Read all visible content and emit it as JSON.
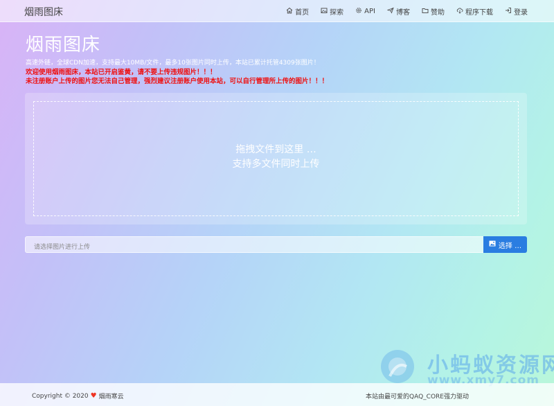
{
  "brand": "烟雨图床",
  "nav": [
    {
      "label": "首页",
      "icon": "home-icon"
    },
    {
      "label": "探索",
      "icon": "image-icon"
    },
    {
      "label": "API",
      "icon": "gear-icon"
    },
    {
      "label": "博客",
      "icon": "plane-icon"
    },
    {
      "label": "赞助",
      "icon": "folder-icon"
    },
    {
      "label": "程序下载",
      "icon": "cloud-download-icon"
    },
    {
      "label": "登录",
      "icon": "login-icon"
    }
  ],
  "hero": {
    "title": "烟雨图床",
    "description": "高速外链，全球CDN加速，支持最大10MB/文件，最多10张图片同时上传，本站已累计托管4309张图片！",
    "warning_1": "欢迎使用烟雨图床，本站已开启鉴黄，请不要上传违规图片！！！",
    "warning_2": "未注册账户上传的图片您无法自己管理，强烈建议注册账户使用本站，可以自行管理所上传的图片！！！"
  },
  "upload": {
    "drop_line_1": "拖拽文件到这里 …",
    "drop_line_2": "支持多文件同时上传",
    "input_placeholder": "请选择图片进行上传",
    "select_button": "选择 …"
  },
  "watermark": {
    "title": "小蚂蚁资源网",
    "url": "www.xmy7.com"
  },
  "footer": {
    "copyright": "Copyright © 2020",
    "site": "烟雨寒云",
    "powered": "本站由最可爱的QAQ_CORE强力驱动"
  },
  "colors": {
    "accent": "#2a7de1",
    "warning": "#ee1111"
  }
}
